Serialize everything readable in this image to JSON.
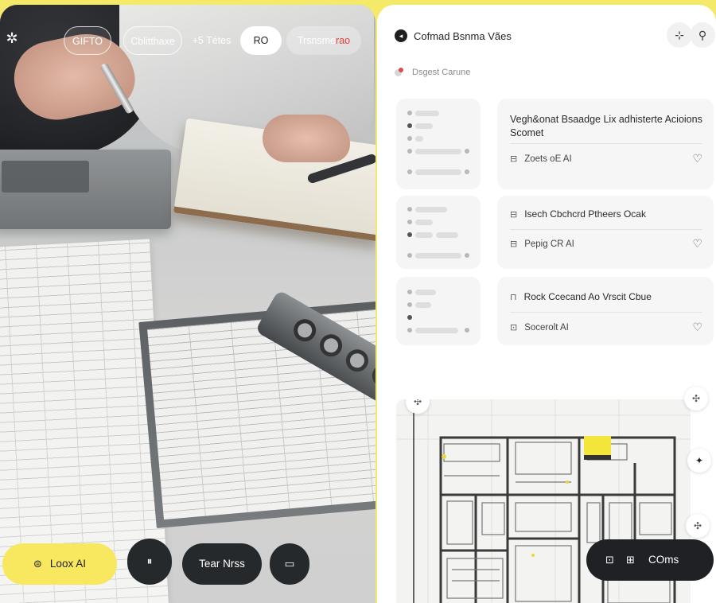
{
  "left": {
    "logo_icon": "✲",
    "chips": [
      {
        "label": "GIFTO"
      },
      {
        "label": "Cblitthaxe"
      },
      {
        "label": "+5 Tétes"
      },
      {
        "label": "RO"
      },
      {
        "label_main": "Trsnsme",
        "label_accent": "rao"
      }
    ],
    "bottom": {
      "look_ai_label": "Loox AI",
      "look_ai_icon": "⊜",
      "pause_icon": "⏸",
      "tasks_label": "Tear Nrss",
      "square_icon": "▭"
    }
  },
  "right": {
    "title_icon": "◂",
    "title": "Cofmad Bsnma Vães",
    "header_buttons": {
      "move_icon": "⊹",
      "person_icon": "⚲"
    },
    "subtitle": "Dsgest Carune",
    "cards": [
      {
        "title": "Vegh&onat Bsaadge Lix adhisterte Acioions Scomet",
        "meta_icon": "⊟",
        "meta": "Zoets oE AI"
      },
      {
        "title": "Isech Cbchcrd Ptheers Ocak",
        "title_icon": "⊟",
        "meta_icon": "⊟",
        "meta": "Pepig CR AI"
      },
      {
        "title": "Rock Ccecand Ao Vrscit Cbue",
        "title_icon": "⊓",
        "meta_icon": "⊡",
        "meta": "Socerolt AI"
      }
    ],
    "heart_icon": "♡",
    "floorplan_corner_icons": [
      "✣",
      "✣",
      "✦",
      "✣"
    ],
    "coms_button": {
      "icon1": "⊡",
      "icon2": "⊞",
      "label": "COms"
    }
  }
}
